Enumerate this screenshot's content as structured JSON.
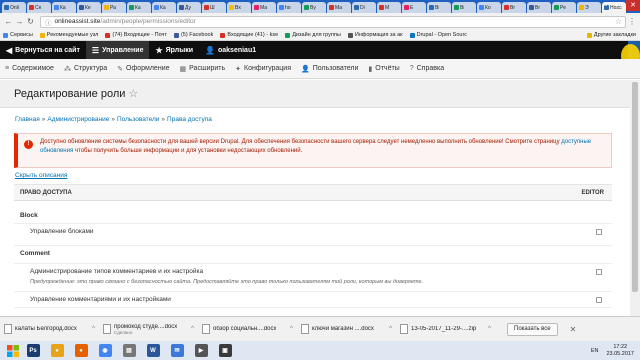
{
  "browser": {
    "tabs": [
      {
        "title": "Onli",
        "color": "#2b6cb0"
      },
      {
        "title": "Ce",
        "color": "#d93025"
      },
      {
        "title": "Ка",
        "color": "#4285f4"
      },
      {
        "title": "Ке",
        "color": "#3b5998"
      },
      {
        "title": "Ра",
        "color": "#f4b400"
      },
      {
        "title": "Ка",
        "color": "#0f9d58"
      },
      {
        "title": "Ка",
        "color": "#4285f4"
      },
      {
        "title": "Ду",
        "color": "#3b5998"
      },
      {
        "title": "Ш",
        "color": "#d93025"
      },
      {
        "title": "Bx",
        "color": "#fbbc05"
      },
      {
        "title": "Ма",
        "color": "#e91e63"
      },
      {
        "title": "ho",
        "color": "#4285f4"
      },
      {
        "title": "By",
        "color": "#0f9d58"
      },
      {
        "title": "Ма",
        "color": "#d93025"
      },
      {
        "title": "Di",
        "color": "#2b6cb0"
      },
      {
        "title": "М",
        "color": "#d93025"
      },
      {
        "title": "E",
        "color": "#e91e63"
      },
      {
        "title": "Bi",
        "color": "#2b6cb0"
      },
      {
        "title": "Bi",
        "color": "#0f9d58"
      },
      {
        "title": "Ко",
        "color": "#4285f4"
      },
      {
        "title": "Br",
        "color": "#d93025"
      },
      {
        "title": "Br",
        "color": "#3b5998"
      },
      {
        "title": "Ре",
        "color": "#0f9d58"
      },
      {
        "title": "Э",
        "color": "#f4b400"
      },
      {
        "title": "Ново",
        "color": "#2b6cb0",
        "active": true
      }
    ],
    "address_host": "onlineassist.site",
    "address_path": "/admin/people/permissions/editor",
    "bookmarks": [
      {
        "label": "Сервисы",
        "color": "#4285f4"
      },
      {
        "label": "Рекомендуемые узл",
        "color": "#f4b400"
      },
      {
        "label": "(74) Входящие - Почт",
        "color": "#d93025"
      },
      {
        "label": "(5) Facebook",
        "color": "#3b5998"
      },
      {
        "label": "Входящие (41) - kse",
        "color": "#d93025"
      },
      {
        "label": "Дизайн для группы",
        "color": "#0f9d58"
      },
      {
        "label": "Информация за ак",
        "color": "#555555"
      },
      {
        "label": "Drupal - Open Sourc",
        "color": "#0678be"
      }
    ],
    "other_bookmarks": "Другие закладки"
  },
  "admin_bar": {
    "back": "Вернуться на сайт",
    "manage": "Управление",
    "shortcuts": "Ярлыки",
    "user": "oakseniau1"
  },
  "tray": [
    {
      "label": "Содержимое",
      "icon": "≡"
    },
    {
      "label": "Структура",
      "icon": "⁂"
    },
    {
      "label": "Оформление",
      "icon": "✎"
    },
    {
      "label": "Расширить",
      "icon": "▦"
    },
    {
      "label": "Конфигурация",
      "icon": "✦"
    },
    {
      "label": "Пользователи",
      "icon": "👤"
    },
    {
      "label": "Отчёты",
      "icon": "▮"
    },
    {
      "label": "Справка",
      "icon": "?"
    }
  ],
  "page": {
    "title": "Редактирование роли",
    "breadcrumb": [
      "Главная",
      "Администрирование",
      "Пользователи",
      "Права доступа"
    ],
    "alert_text_1": "Доступно обновление системы безопасности для вашей версии Drupal. Для обеспечения безопасности вашего сервера следует немедленно выполнить обновление! Смотрите страницу ",
    "alert_link": "доступные обновления",
    "alert_text_2": " чтобы получить больше информации и для установки недостающих обновлений.",
    "hide_descriptions": "Скрыть описания",
    "table": {
      "col_permission": "ПРАВО ДОСТУПА",
      "col_role": "EDITOR",
      "rows": [
        {
          "type": "module",
          "name": "Block"
        },
        {
          "type": "perm",
          "name": "Управление блоками"
        },
        {
          "type": "module",
          "name": "Comment"
        },
        {
          "type": "perm",
          "name": "Администрирование типов комментариев и их настройка",
          "desc": "Предупреждение: это право связано с безопасностью сайта. Предоставляйте это право только пользователям той роли, которым вы доверяете."
        },
        {
          "type": "perm",
          "name": "Управление комментариями и их настройками"
        }
      ]
    }
  },
  "downloads": {
    "items": [
      {
        "name": "калаты Белгород.docx",
        "sub": ""
      },
      {
        "name": "промокод студе....docx",
        "sub": "Сделано"
      },
      {
        "name": "обзор социальн....docx",
        "sub": ""
      },
      {
        "name": "ключи магазин ....docx",
        "sub": ""
      },
      {
        "name": "13-05-2017_11-29-....zip",
        "sub": ""
      }
    ],
    "show_all": "Показать все"
  },
  "taskbar": {
    "apps": [
      {
        "label": "Ps",
        "color": "#1d3c6e"
      },
      {
        "label": "●",
        "color": "#e8a31b"
      },
      {
        "label": "●",
        "color": "#e66000"
      },
      {
        "label": "◉",
        "color": "#4285f4"
      },
      {
        "label": "▤",
        "color": "#777777"
      },
      {
        "label": "W",
        "color": "#2b579a"
      },
      {
        "label": "✉",
        "color": "#3c78d8"
      },
      {
        "label": "▶",
        "color": "#555555"
      },
      {
        "label": "▣",
        "color": "#3a3a3a"
      }
    ],
    "lang": "EN",
    "time": "17:22",
    "date": "23.05.2017"
  }
}
